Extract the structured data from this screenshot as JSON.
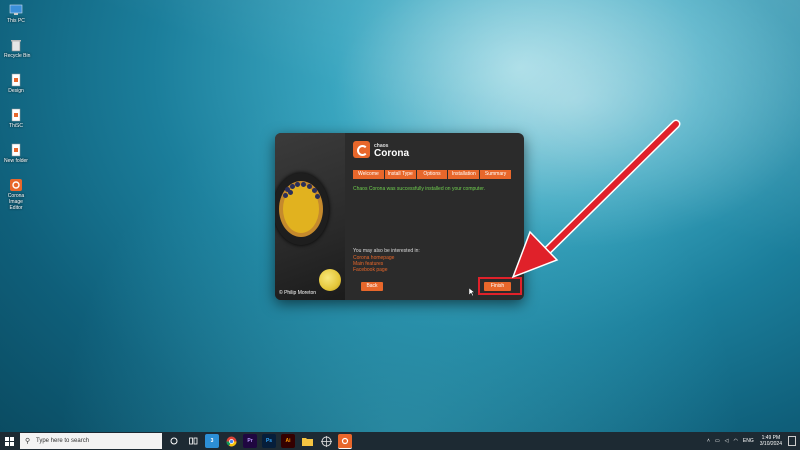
{
  "desktop": {
    "icons": [
      {
        "label": "This PC",
        "icon": "computer-icon"
      },
      {
        "label": "Recycle Bin",
        "icon": "recycle-bin-icon"
      },
      {
        "label": "Design",
        "icon": "document-icon"
      },
      {
        "label": "ThiSC",
        "icon": "document-icon"
      },
      {
        "label": "New folder",
        "icon": "document-icon"
      },
      {
        "label": "Corona Image Editor",
        "icon": "corona-app-icon"
      }
    ]
  },
  "installer": {
    "brand_small": "chaos",
    "brand_name": "Corona",
    "tabs": [
      {
        "label": "Welcome"
      },
      {
        "label": "Install Type"
      },
      {
        "label": "Options"
      },
      {
        "label": "Installation"
      },
      {
        "label": "Summary"
      }
    ],
    "success_message": "Chaos Corona was successfully installed on your computer.",
    "interest_label": "You may also be interested in:",
    "links": [
      {
        "label": "Corona homepage"
      },
      {
        "label": "Main features"
      },
      {
        "label": "Facebook page"
      }
    ],
    "photo_credit": "© Philip Moreton",
    "back_label": "Back",
    "finish_label": "Finish",
    "accent_color": "#e8672b",
    "success_color": "#6fcf4e"
  },
  "taskbar": {
    "search_placeholder": "Type here to search",
    "apps": [
      {
        "name": "cortana-icon"
      },
      {
        "name": "task-view-icon"
      },
      {
        "name": "app-icon-blue"
      },
      {
        "name": "chrome-icon"
      },
      {
        "name": "premiere-icon",
        "label": "Pr"
      },
      {
        "name": "photoshop-icon",
        "label": "Ps"
      },
      {
        "name": "illustrator-icon",
        "label": "Ai"
      },
      {
        "name": "file-explorer-icon"
      },
      {
        "name": "app-icon-target"
      },
      {
        "name": "corona-taskbar-icon"
      }
    ],
    "language": "ENG",
    "time": "1:49 PM",
    "date": "3/10/2024"
  },
  "annotation_color": "#e0212a"
}
